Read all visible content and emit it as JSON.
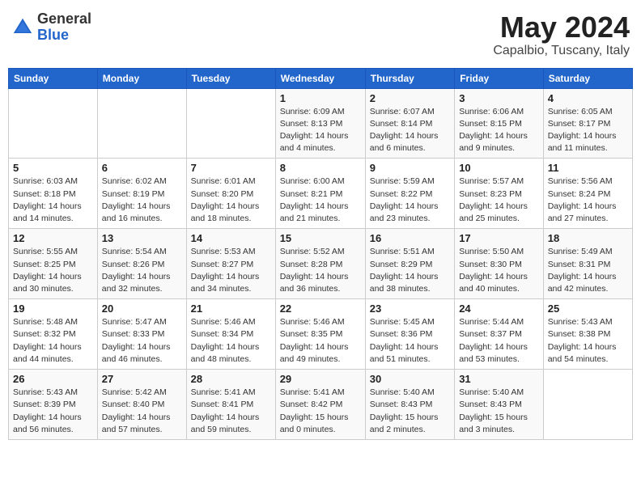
{
  "header": {
    "logo_general": "General",
    "logo_blue": "Blue",
    "month_year": "May 2024",
    "location": "Capalbio, Tuscany, Italy"
  },
  "calendar": {
    "days_of_week": [
      "Sunday",
      "Monday",
      "Tuesday",
      "Wednesday",
      "Thursday",
      "Friday",
      "Saturday"
    ],
    "weeks": [
      [
        {
          "day": "",
          "info": ""
        },
        {
          "day": "",
          "info": ""
        },
        {
          "day": "",
          "info": ""
        },
        {
          "day": "1",
          "info": "Sunrise: 6:09 AM\nSunset: 8:13 PM\nDaylight: 14 hours\nand 4 minutes."
        },
        {
          "day": "2",
          "info": "Sunrise: 6:07 AM\nSunset: 8:14 PM\nDaylight: 14 hours\nand 6 minutes."
        },
        {
          "day": "3",
          "info": "Sunrise: 6:06 AM\nSunset: 8:15 PM\nDaylight: 14 hours\nand 9 minutes."
        },
        {
          "day": "4",
          "info": "Sunrise: 6:05 AM\nSunset: 8:17 PM\nDaylight: 14 hours\nand 11 minutes."
        }
      ],
      [
        {
          "day": "5",
          "info": "Sunrise: 6:03 AM\nSunset: 8:18 PM\nDaylight: 14 hours\nand 14 minutes."
        },
        {
          "day": "6",
          "info": "Sunrise: 6:02 AM\nSunset: 8:19 PM\nDaylight: 14 hours\nand 16 minutes."
        },
        {
          "day": "7",
          "info": "Sunrise: 6:01 AM\nSunset: 8:20 PM\nDaylight: 14 hours\nand 18 minutes."
        },
        {
          "day": "8",
          "info": "Sunrise: 6:00 AM\nSunset: 8:21 PM\nDaylight: 14 hours\nand 21 minutes."
        },
        {
          "day": "9",
          "info": "Sunrise: 5:59 AM\nSunset: 8:22 PM\nDaylight: 14 hours\nand 23 minutes."
        },
        {
          "day": "10",
          "info": "Sunrise: 5:57 AM\nSunset: 8:23 PM\nDaylight: 14 hours\nand 25 minutes."
        },
        {
          "day": "11",
          "info": "Sunrise: 5:56 AM\nSunset: 8:24 PM\nDaylight: 14 hours\nand 27 minutes."
        }
      ],
      [
        {
          "day": "12",
          "info": "Sunrise: 5:55 AM\nSunset: 8:25 PM\nDaylight: 14 hours\nand 30 minutes."
        },
        {
          "day": "13",
          "info": "Sunrise: 5:54 AM\nSunset: 8:26 PM\nDaylight: 14 hours\nand 32 minutes."
        },
        {
          "day": "14",
          "info": "Sunrise: 5:53 AM\nSunset: 8:27 PM\nDaylight: 14 hours\nand 34 minutes."
        },
        {
          "day": "15",
          "info": "Sunrise: 5:52 AM\nSunset: 8:28 PM\nDaylight: 14 hours\nand 36 minutes."
        },
        {
          "day": "16",
          "info": "Sunrise: 5:51 AM\nSunset: 8:29 PM\nDaylight: 14 hours\nand 38 minutes."
        },
        {
          "day": "17",
          "info": "Sunrise: 5:50 AM\nSunset: 8:30 PM\nDaylight: 14 hours\nand 40 minutes."
        },
        {
          "day": "18",
          "info": "Sunrise: 5:49 AM\nSunset: 8:31 PM\nDaylight: 14 hours\nand 42 minutes."
        }
      ],
      [
        {
          "day": "19",
          "info": "Sunrise: 5:48 AM\nSunset: 8:32 PM\nDaylight: 14 hours\nand 44 minutes."
        },
        {
          "day": "20",
          "info": "Sunrise: 5:47 AM\nSunset: 8:33 PM\nDaylight: 14 hours\nand 46 minutes."
        },
        {
          "day": "21",
          "info": "Sunrise: 5:46 AM\nSunset: 8:34 PM\nDaylight: 14 hours\nand 48 minutes."
        },
        {
          "day": "22",
          "info": "Sunrise: 5:46 AM\nSunset: 8:35 PM\nDaylight: 14 hours\nand 49 minutes."
        },
        {
          "day": "23",
          "info": "Sunrise: 5:45 AM\nSunset: 8:36 PM\nDaylight: 14 hours\nand 51 minutes."
        },
        {
          "day": "24",
          "info": "Sunrise: 5:44 AM\nSunset: 8:37 PM\nDaylight: 14 hours\nand 53 minutes."
        },
        {
          "day": "25",
          "info": "Sunrise: 5:43 AM\nSunset: 8:38 PM\nDaylight: 14 hours\nand 54 minutes."
        }
      ],
      [
        {
          "day": "26",
          "info": "Sunrise: 5:43 AM\nSunset: 8:39 PM\nDaylight: 14 hours\nand 56 minutes."
        },
        {
          "day": "27",
          "info": "Sunrise: 5:42 AM\nSunset: 8:40 PM\nDaylight: 14 hours\nand 57 minutes."
        },
        {
          "day": "28",
          "info": "Sunrise: 5:41 AM\nSunset: 8:41 PM\nDaylight: 14 hours\nand 59 minutes."
        },
        {
          "day": "29",
          "info": "Sunrise: 5:41 AM\nSunset: 8:42 PM\nDaylight: 15 hours\nand 0 minutes."
        },
        {
          "day": "30",
          "info": "Sunrise: 5:40 AM\nSunset: 8:43 PM\nDaylight: 15 hours\nand 2 minutes."
        },
        {
          "day": "31",
          "info": "Sunrise: 5:40 AM\nSunset: 8:43 PM\nDaylight: 15 hours\nand 3 minutes."
        },
        {
          "day": "",
          "info": ""
        }
      ]
    ]
  }
}
